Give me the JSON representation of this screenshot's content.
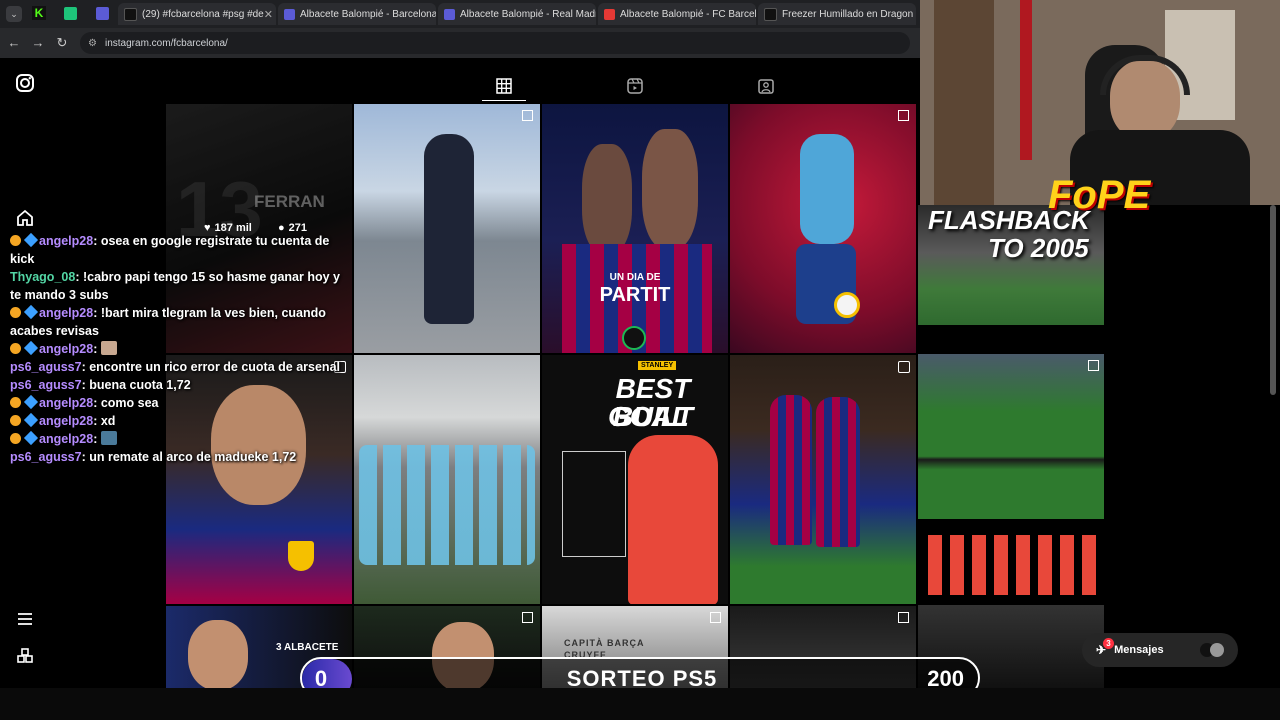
{
  "browser": {
    "tabs": [
      {
        "label": "(29) #fcbarcelona #psg #de",
        "color": "#e1306c"
      },
      {
        "label": "Albacete Balompié - Barcelona",
        "color": "#5b5bd6"
      },
      {
        "label": "Albacete Balompié - Real Madr",
        "color": "#5b5bd6"
      },
      {
        "label": "Albacete Balompié - FC Barcelo",
        "color": "#e53935"
      },
      {
        "label": "Freezer Humillado en Dragon B",
        "color": "#111111"
      }
    ],
    "url": "instagram.com/fcbarcelona/"
  },
  "instagram": {
    "tab_icons": [
      "grid-icon",
      "reels-icon",
      "tagged-icon"
    ],
    "first_post": {
      "likes": "187 mil",
      "comments": "271",
      "name": "FERRAN",
      "number": "13"
    },
    "post_texts": {
      "partit_top": "UN DIA DE",
      "partit_main": "PARTIT",
      "best_built": "BEST BUILT",
      "goal": "GOAL",
      "stanley": "STANLEY",
      "albacete": "3 ALBACETE",
      "capita": "CAPITÀ BARÇA",
      "cruyff": "CRUYFF"
    },
    "messages_label": "Mensajes",
    "messages_count": "3"
  },
  "chat": [
    {
      "user": "angelp28",
      "color": "purple",
      "text": "osea en google registrate tu cuenta de kick"
    },
    {
      "user": "Thyago_08",
      "color": "green",
      "text": "!cabro papi tengo 15 so hasme ganar hoy y te mando 3 subs"
    },
    {
      "user": "angelp28",
      "color": "purple",
      "text": "!bart mira tlegram la ves bien, cuando acabes revisas"
    },
    {
      "user": "angelp28",
      "color": "purple",
      "text": ""
    },
    {
      "user": "ps6_aguss7",
      "color": "purple",
      "text": "encontre un rico error de cuota de arsenal"
    },
    {
      "user": "ps6_aguss7",
      "color": "purple",
      "text": "buena cuota 1,72"
    },
    {
      "user": "angelp28",
      "color": "purple",
      "text": "como sea"
    },
    {
      "user": "angelp28",
      "color": "purple",
      "text": "xd"
    },
    {
      "user": "angelp28",
      "color": "purple",
      "text": ""
    },
    {
      "user": "ps6_aguss7",
      "color": "purple",
      "text": "un remate al arco de madueke 1,72"
    }
  ],
  "stream": {
    "flashback_line1": "FLASHBACK",
    "flashback_line2": "TO 2005",
    "brand": "FoPE",
    "sorteo_label": "SORTEO PS5",
    "sorteo_left": "0",
    "sorteo_right": "200"
  }
}
